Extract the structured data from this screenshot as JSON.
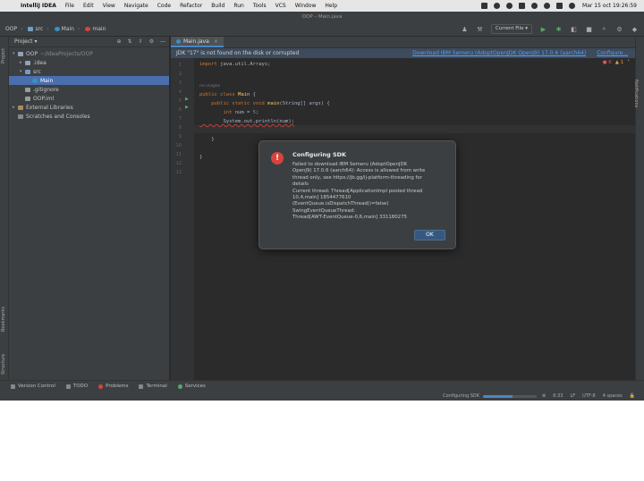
{
  "menubar": {
    "app_name": "IntelliJ IDEA",
    "items": [
      "File",
      "Edit",
      "View",
      "Navigate",
      "Code",
      "Refactor",
      "Build",
      "Run",
      "Tools",
      "VCS",
      "Window",
      "Help"
    ],
    "clock": "Mar 15 oct 19:26:59"
  },
  "window_title": "OOP – Main.java",
  "breadcrumbs": [
    "OOP",
    "src",
    "Main",
    "main"
  ],
  "toolbar": {
    "run_config": "Current File"
  },
  "stripes": {
    "project": "Project",
    "bookmarks": "Bookmarks",
    "structure": "Structure",
    "notifications": "Notifications"
  },
  "project_panel": {
    "title": "Project",
    "tree": [
      {
        "name": "OOP",
        "detail": "~/IdeaProjects/OOP",
        "indent": 0,
        "arrow": "▾",
        "icon": "folder"
      },
      {
        "name": ".idea",
        "detail": "",
        "indent": 1,
        "arrow": "▸",
        "icon": "folder"
      },
      {
        "name": "src",
        "detail": "",
        "indent": 1,
        "arrow": "▾",
        "icon": "src-folder"
      },
      {
        "name": "Main",
        "detail": "",
        "indent": 2,
        "arrow": "",
        "icon": "class"
      },
      {
        "name": ".gitignore",
        "detail": "",
        "indent": 1,
        "arrow": "",
        "icon": "file"
      },
      {
        "name": "OOP.iml",
        "detail": "",
        "indent": 1,
        "arrow": "",
        "icon": "file"
      },
      {
        "name": "External Libraries",
        "detail": "",
        "indent": 0,
        "arrow": "▸",
        "icon": "library"
      },
      {
        "name": "Scratches and Consoles",
        "detail": "",
        "indent": 0,
        "arrow": "",
        "icon": "scratch"
      }
    ]
  },
  "editor": {
    "tab_label": "Main.java",
    "banner_text": "JDK \"17\" is not found on the disk or corrupted",
    "banner_link_download": "Download IBM Semeru (AdoptOpenJDK OpenJ9) 17.0.6 (aarch64)",
    "banner_link_configure": "Configure...",
    "inspections": {
      "errors": "6",
      "warnings": "1"
    },
    "line_numbers": [
      "1",
      "2",
      "3",
      "4",
      "5",
      "6",
      "7",
      "8",
      "9",
      "10",
      "11",
      "12",
      "13"
    ],
    "code": {
      "l1_kw": "import",
      "l1_rest": " java.util.Arrays;",
      "hint": "no usages",
      "l3_kw": "public class",
      "l3_cls": " Main",
      "l3_rest": " {",
      "l4_kw": "    public static void",
      "l4_method": " main",
      "l4_rest": "(String[] args) {",
      "l5_kw": "        int",
      "l5_rest": " num = ",
      "l5_num": "5",
      "l5_end": ";",
      "l6": "        System.out.println(num);",
      "l8": "    }",
      "l10": "}"
    }
  },
  "dialog": {
    "title": "Configuring SDK",
    "message_lines": [
      "Failed to download IBM Semeru (AdoptOpenJDK",
      "OpenJ9) 17.0.6 (aarch64): Access is allowed from write",
      "thread only, see https://jb.gg/ij-platform-threading for",
      "details",
      "Current thread: Thread[ApplicationImpl pooled thread",
      "10,4,main] 1854477610",
      "(EventQueue.isDispatchThread()=false)",
      "SwingEventQueueThread:",
      "Thread[AWT-EventQueue-0,6,main] 331180275"
    ],
    "ok_label": "OK"
  },
  "bottom_tools": [
    "Version Control",
    "TODO",
    "Problems",
    "Terminal",
    "Services"
  ],
  "statusbar": {
    "task": "Configuring SDK",
    "progress": 0.55,
    "position": "6:33",
    "line_sep": "LF",
    "encoding": "UTF-8",
    "indent": "4 spaces"
  }
}
